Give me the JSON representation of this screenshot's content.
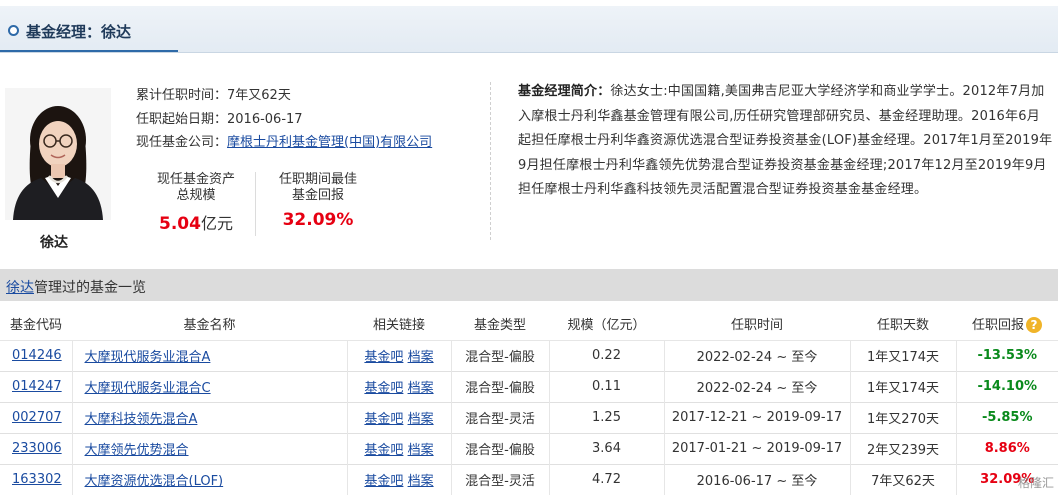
{
  "header": {
    "title": "基金经理：徐达"
  },
  "manager": {
    "name": "徐达",
    "tenure_label": "累计任职时间：",
    "tenure_value": "7年又62天",
    "start_label": "任职起始日期：",
    "start_value": "2016-06-17",
    "company_label": "现任基金公司：",
    "company_value": "摩根士丹利基金管理(中国)有限公司",
    "stat_assets_label_1": "现任基金资产",
    "stat_assets_label_2": "总规模",
    "stat_assets_value": "5.04",
    "stat_assets_unit": "亿元",
    "stat_return_label_1": "任职期间最佳",
    "stat_return_label_2": "基金回报",
    "stat_return_value": "32.09%",
    "bio_label": "基金经理简介：",
    "bio_text": "徐达女士:中国国籍,美国弗吉尼亚大学经济学和商业学学士。2012年7月加入摩根士丹利华鑫基金管理有限公司,历任研究管理部研究员、基金经理助理。2016年6月起担任摩根士丹利华鑫资源优选混合型证券投资基金(LOF)基金经理。2017年1月至2019年9月担任摩根士丹利华鑫领先优势混合型证券投资基金基金经理;2017年12月至2019年9月担任摩根士丹利华鑫科技领先灵活配置混合型证券投资基金基金经理。"
  },
  "section": {
    "name_link": "徐达",
    "title_suffix": "管理过的基金一览"
  },
  "table": {
    "headers": [
      "基金代码",
      "基金名称",
      "相关链接",
      "基金类型",
      "规模（亿元）",
      "任职时间",
      "任职天数",
      "任职回报"
    ],
    "rows": [
      {
        "code": "014246",
        "name": "大摩现代服务业混合A",
        "link1": "基金吧",
        "link2": "档案",
        "type": "混合型-偏股",
        "size": "0.22",
        "period": "2022-02-24 ~ 至今",
        "days": "1年又174天",
        "return": "-13.53%"
      },
      {
        "code": "014247",
        "name": "大摩现代服务业混合C",
        "link1": "基金吧",
        "link2": "档案",
        "type": "混合型-偏股",
        "size": "0.11",
        "period": "2022-02-24 ~ 至今",
        "days": "1年又174天",
        "return": "-14.10%"
      },
      {
        "code": "002707",
        "name": "大摩科技领先混合A",
        "link1": "基金吧",
        "link2": "档案",
        "type": "混合型-灵活",
        "size": "1.25",
        "period": "2017-12-21 ~ 2019-09-17",
        "days": "1年又270天",
        "return": "-5.85%"
      },
      {
        "code": "233006",
        "name": "大摩领先优势混合",
        "link1": "基金吧",
        "link2": "档案",
        "type": "混合型-偏股",
        "size": "3.64",
        "period": "2017-01-21 ~ 2019-09-17",
        "days": "2年又239天",
        "return": "8.86%"
      },
      {
        "code": "163302",
        "name": "大摩资源优选混合(LOF)",
        "link1": "基金吧",
        "link2": "档案",
        "type": "混合型-灵活",
        "size": "4.72",
        "period": "2016-06-17 ~ 至今",
        "days": "7年又62天",
        "return": "32.09%"
      }
    ]
  },
  "watermark": "格隆汇",
  "icons": {
    "header": "circle-icon",
    "help": "help-icon"
  },
  "colors": {
    "negative": "#0a8a1c",
    "positive": "#e60012",
    "link": "#1a4ba0"
  }
}
